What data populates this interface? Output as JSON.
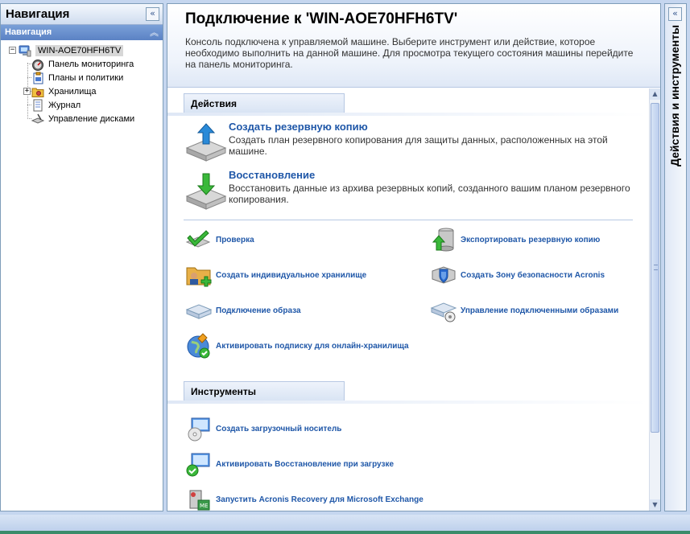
{
  "navigation": {
    "title": "Навигация",
    "collapse_icon": "double-chevron-left-icon",
    "subheader": "Навигация",
    "tree": {
      "root": {
        "label": "WIN-AOE70HFH6TV",
        "icon": "computer-icon",
        "expanded": true
      },
      "children": [
        {
          "label": "Панель мониторинга",
          "icon": "dashboard-icon"
        },
        {
          "label": "Планы и политики",
          "icon": "clipboard-icon"
        },
        {
          "label": "Хранилища",
          "icon": "vault-folder-icon",
          "expandable": true
        },
        {
          "label": "Журнал",
          "icon": "log-icon"
        },
        {
          "label": "Управление дисками",
          "icon": "disk-management-icon"
        }
      ]
    }
  },
  "main": {
    "title": "Подключение к 'WIN-AOE70HFH6TV'",
    "description": "Консоль подключена к управляемой машине. Выберите инструмент или действие, которое необходимо выполнить на данной машине. Для просмотра текущего состояния машины перейдите на панель мониторинга.",
    "actions_section": {
      "title": "Действия",
      "primary": [
        {
          "title": "Создать резервную копию",
          "description": "Создать план резервного копирования для защиты данных, расположенных на этой машине.",
          "icon": "backup-disk-up-arrow-icon"
        },
        {
          "title": "Восстановление",
          "description": "Восстановить данные из архива резервных копий, созданного вашим планом резервного копирования.",
          "icon": "recover-disk-down-arrow-icon"
        }
      ],
      "secondary": [
        {
          "label": "Проверка",
          "icon": "validate-checkmark-icon"
        },
        {
          "label": "Экспортировать резервную копию",
          "icon": "export-backup-icon"
        },
        {
          "label": "Создать индивидуальное хранилище",
          "icon": "create-vault-icon"
        },
        {
          "label": "Создать Зону безопасности Acronis",
          "icon": "secure-zone-icon"
        },
        {
          "label": "Подключение образа",
          "icon": "mount-image-icon"
        },
        {
          "label": "Управление подключенными образами",
          "icon": "manage-mounted-images-icon"
        },
        {
          "label": "Активировать подписку для онлайн-хранилища",
          "icon": "online-subscription-icon"
        }
      ]
    },
    "tools_section": {
      "title": "Инструменты",
      "items": [
        {
          "label": "Создать загрузочный носитель",
          "icon": "bootable-media-icon"
        },
        {
          "label": "Активировать Восстановление при загрузке",
          "icon": "startup-recovery-icon"
        },
        {
          "label": "Запустить Acronis Recovery для Microsoft Exchange",
          "icon": "exchange-recovery-icon"
        }
      ]
    }
  },
  "actions_panel": {
    "title": "Действия и инструменты",
    "expand_icon": "double-chevron-left-icon"
  },
  "colors": {
    "link": "#1f57a8",
    "panel_border": "#7f9db9",
    "nav_subheader": "#5b82c4",
    "desktop": "#c5d6ef"
  }
}
